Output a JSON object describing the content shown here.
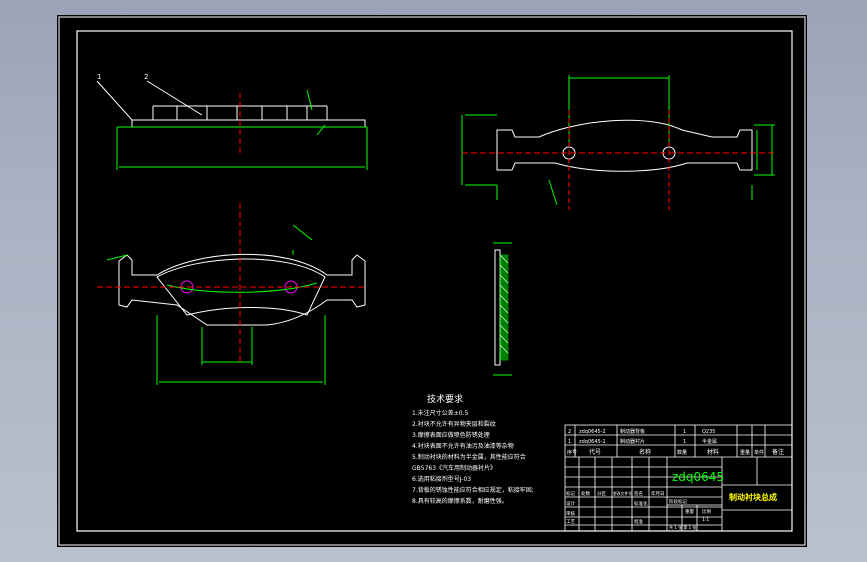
{
  "drawing": {
    "title_cn": "制动衬块总成",
    "drawing_code": "zdq0645",
    "notes_heading": "技术要求",
    "notes": [
      "1.未注尺寸公差±0.5",
      "2.衬块不允许有异物夹层和裂纹",
      "3.摩擦表面应做喷色防锈处理",
      "4.衬块表面不允许有油污及油漆等杂物",
      "5.制动衬块的材料为半金属，其性能应符合",
      "GB5763《汽车用制动器衬片》",
      "6.选用粘接剂型号J-03",
      "7.背板的锈蚀性能应符合相应规定，粘接牢固;",
      "8.具有较高的摩擦系数，耐磨性强。"
    ],
    "balloons": [
      "1",
      "2"
    ],
    "bom": {
      "rows": [
        [
          "2",
          "zdq0645-2",
          "制动器背板",
          "1",
          "Q235",
          ""
        ],
        [
          "1",
          "zdq0645-1",
          "制动器衬片",
          "1",
          "半金属",
          ""
        ]
      ],
      "header": [
        "序号",
        "代号",
        "名称",
        "数量",
        "材料",
        "重量",
        "单件",
        "备注"
      ]
    },
    "title_block": {
      "labels": [
        "标记",
        "处数",
        "分区",
        "更改文件号",
        "签名",
        "年月日",
        "设计",
        "标准化",
        "审核",
        "工艺",
        "批准",
        "阶段标记",
        "重量",
        "比例"
      ],
      "sheet": "1:1",
      "sheet_count": "共 1 张 第 1 张"
    }
  },
  "colors": {
    "frame": "#ffffff",
    "geometry": "#00ff00",
    "center": "#ff0000",
    "dimension": "#00ff00",
    "code": "#00ff00",
    "title": "#ffff00",
    "highlight": "#ff00ff"
  }
}
